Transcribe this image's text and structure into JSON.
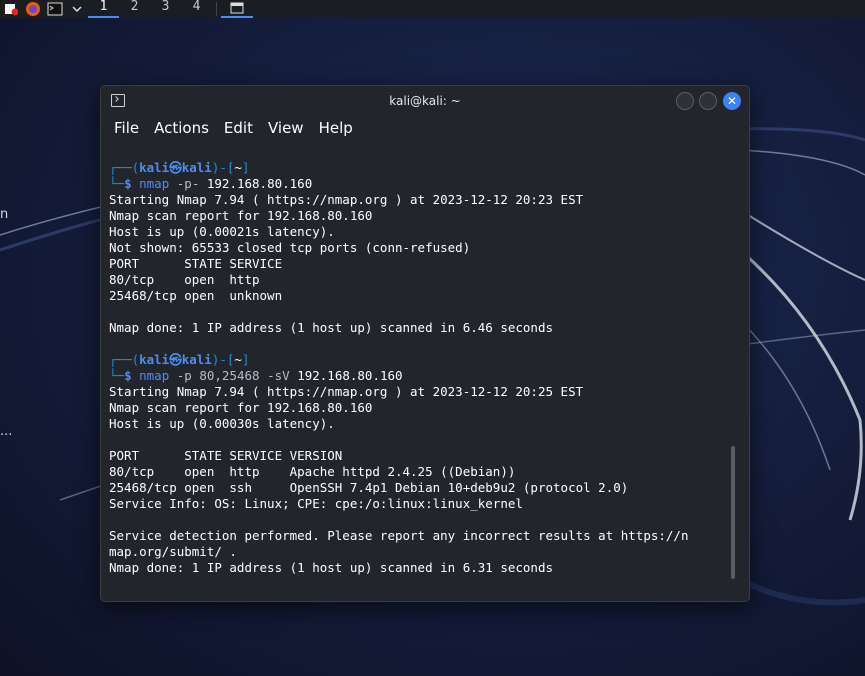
{
  "panel": {
    "workspaces": [
      "1",
      "2",
      "3",
      "4"
    ],
    "active_workspace": 0
  },
  "desktop": {
    "edge_text_1": "n",
    "edge_text_2": "..."
  },
  "window": {
    "title": "kali@kali: ~",
    "menu": [
      "File",
      "Actions",
      "Edit",
      "View",
      "Help"
    ]
  },
  "terminal": {
    "prompt": {
      "user": "kali",
      "at": "㉿",
      "host": "kali",
      "dir": "~"
    },
    "blocks": [
      {
        "command": {
          "name": "nmap",
          "flags": "-p-",
          "target": "192.168.80.160"
        },
        "output": [
          "Starting Nmap 7.94 ( https://nmap.org ) at 2023-12-12 20:23 EST",
          "Nmap scan report for 192.168.80.160",
          "Host is up (0.00021s latency).",
          "Not shown: 65533 closed tcp ports (conn-refused)",
          "PORT      STATE SERVICE",
          "80/tcp    open  http",
          "25468/tcp open  unknown",
          "",
          "Nmap done: 1 IP address (1 host up) scanned in 6.46 seconds",
          ""
        ]
      },
      {
        "command": {
          "name": "nmap",
          "flags": "-p 80,25468 -sV",
          "target": "192.168.80.160"
        },
        "output": [
          "Starting Nmap 7.94 ( https://nmap.org ) at 2023-12-12 20:25 EST",
          "Nmap scan report for 192.168.80.160",
          "Host is up (0.00030s latency).",
          "",
          "PORT      STATE SERVICE VERSION",
          "80/tcp    open  http    Apache httpd 2.4.25 ((Debian))",
          "25468/tcp open  ssh     OpenSSH 7.4p1 Debian 10+deb9u2 (protocol 2.0)",
          "Service Info: OS: Linux; CPE: cpe:/o:linux:linux_kernel",
          "",
          "Service detection performed. Please report any incorrect results at https://n",
          "map.org/submit/ .",
          "Nmap done: 1 IP address (1 host up) scanned in 6.31 seconds"
        ]
      }
    ]
  }
}
